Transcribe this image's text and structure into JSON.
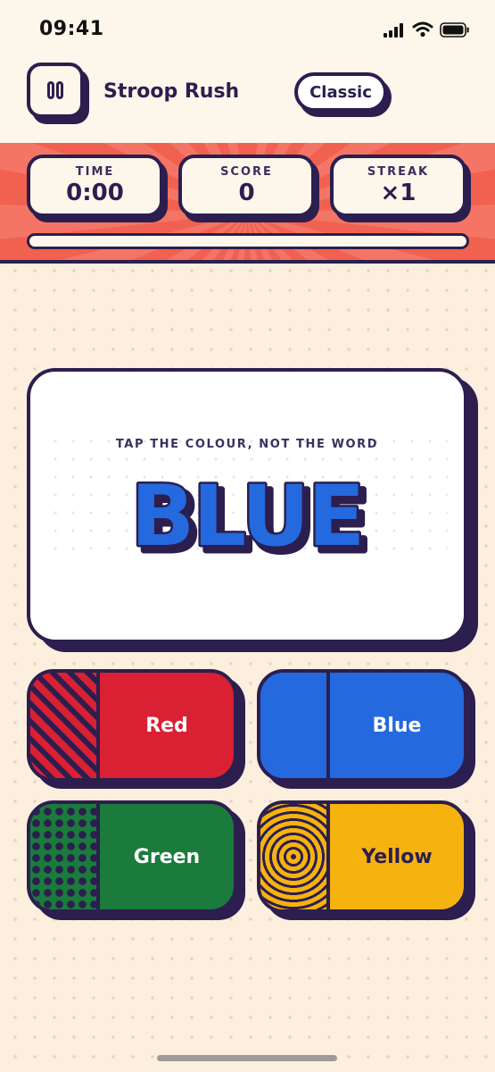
{
  "status_bar": {
    "time": "09:41"
  },
  "header": {
    "title": "Stroop Rush",
    "mode": "Classic"
  },
  "hud": {
    "time_label": "TIME",
    "time_value": "0:00",
    "score_label": "SCORE",
    "score_value": "0",
    "streak_label": "STREAK",
    "streak_value": "×1",
    "progress": 0.0
  },
  "card": {
    "instruction": "TAP THE COLOUR, NOT THE WORD",
    "word": "BLUE",
    "word_color": "#2469DE"
  },
  "answers": [
    {
      "label": "Red",
      "color": "#DA2033",
      "text_color": "#FFFFFF",
      "pattern": "stripes"
    },
    {
      "label": "Blue",
      "color": "#2469DE",
      "text_color": "#FFFFFF",
      "pattern": "solid"
    },
    {
      "label": "Green",
      "color": "#1A7B3C",
      "text_color": "#FFFFFF",
      "pattern": "dots"
    },
    {
      "label": "Yellow",
      "color": "#F6B30F",
      "text_color": "#2C1E4F",
      "pattern": "rings"
    }
  ],
  "colors": {
    "ink": "#2C1E4F",
    "cream": "#FDF6EA",
    "page_bg": "#FDEFDE",
    "hud_red": "#F0614F"
  }
}
